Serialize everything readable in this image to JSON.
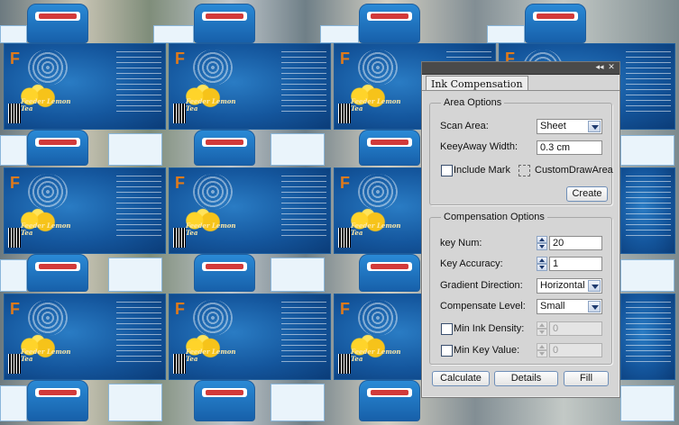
{
  "panel": {
    "controls": {
      "collapse_icon": "double-chevron-left-icon",
      "close_icon": "close-icon",
      "collapse_glyph": "◂◂",
      "close_glyph": "✕"
    },
    "tab_label": "Ink Compensation",
    "area_options": {
      "title": "Area Options",
      "scan_area_label": "Scan Area:",
      "scan_area_value": "Sheet",
      "keyaway_width_label": "KeeyAway Width:",
      "keyaway_width_value": "0.3 cm",
      "include_mark_label": "Include Mark",
      "include_mark_checked": false,
      "custom_draw_area_label": "CustomDrawArea",
      "custom_draw_area_checked": false,
      "create_button": "Create"
    },
    "compensation_options": {
      "title": "Compensation Options",
      "key_num_label": "key Num:",
      "key_num_value": "20",
      "key_accuracy_label": "Key Accuracy:",
      "key_accuracy_value": "1",
      "gradient_direction_label": "Gradient Direction:",
      "gradient_direction_value": "Horizontal",
      "compensate_level_label": "Compensate Level:",
      "compensate_level_value": "Small",
      "min_ink_density_label": "Min Ink Density:",
      "min_ink_density_checked": false,
      "min_ink_density_value": "0",
      "min_key_value_label": "Min Key Value:",
      "min_key_value_checked": false,
      "min_key_value_value": "0"
    },
    "buttons": {
      "calculate": "Calculate",
      "details": "Details",
      "fill": "Fill"
    }
  },
  "artwork": {
    "logo_letter": "F",
    "product_script": "Feeder Lemon Tea",
    "accent_colors": {
      "box_blue": "#14569d",
      "lemon": "#ffd42a",
      "logo_orange": "#e07a1a"
    }
  }
}
